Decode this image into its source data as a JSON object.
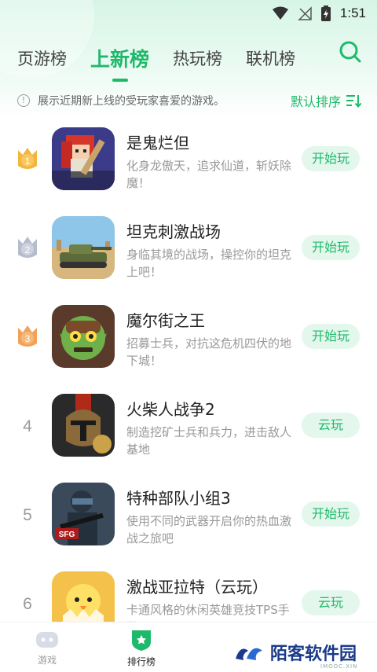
{
  "status_bar": {
    "time": "1:51"
  },
  "tabs": [
    {
      "label": "页游榜",
      "active": false
    },
    {
      "label": "上新榜",
      "active": true
    },
    {
      "label": "热玩榜",
      "active": false
    },
    {
      "label": "联机榜",
      "active": false
    }
  ],
  "info": {
    "text": "展示近期新上线的受玩家喜爱的游戏。",
    "sort_label": "默认排序"
  },
  "games": [
    {
      "rank": "1",
      "title": "是鬼烂但",
      "desc": "化身龙傲天，追求仙道，斩妖除魔！",
      "button": "开始玩",
      "medal": "gold",
      "icon_name": "pixel-warrior-icon"
    },
    {
      "rank": "2",
      "title": "坦克刺激战场",
      "desc": "身临其境的战场，操控你的坦克上吧！",
      "button": "开始玩",
      "medal": "silver",
      "icon_name": "tank-icon"
    },
    {
      "rank": "3",
      "title": "魔尔街之王",
      "desc": "招募士兵，对抗这危机四伏的地下城！",
      "button": "开始玩",
      "medal": "bronze",
      "icon_name": "goblin-icon"
    },
    {
      "rank": "4",
      "title": "火柴人战争2",
      "desc": "制造挖矿士兵和兵力，进击敌人基地",
      "button": "云玩",
      "medal": "",
      "icon_name": "spartan-icon"
    },
    {
      "rank": "5",
      "title": "特种部队小组3",
      "desc": "使用不同的武器开启你的热血激战之旅吧",
      "button": "开始玩",
      "medal": "",
      "icon_name": "soldier-icon"
    },
    {
      "rank": "6",
      "title": "激战亚拉特（云玩）",
      "desc": "卡通风格的休闲英雄竞技TPS手游",
      "button": "云玩",
      "medal": "",
      "icon_name": "chick-icon"
    }
  ],
  "bottom_nav": [
    {
      "label": "游戏",
      "icon": "gamepad-icon",
      "active": false
    },
    {
      "label": "排行榜",
      "icon": "ranking-shield-icon",
      "active": true
    }
  ],
  "watermark": {
    "text": "陌客软件园",
    "sub": "IMOOC.XIN"
  },
  "colors": {
    "accent": "#1fb96b",
    "button_bg": "#e3f7ec",
    "gold": "#f3b53c",
    "silver": "#b5bccb",
    "bronze": "#f0a25a"
  }
}
